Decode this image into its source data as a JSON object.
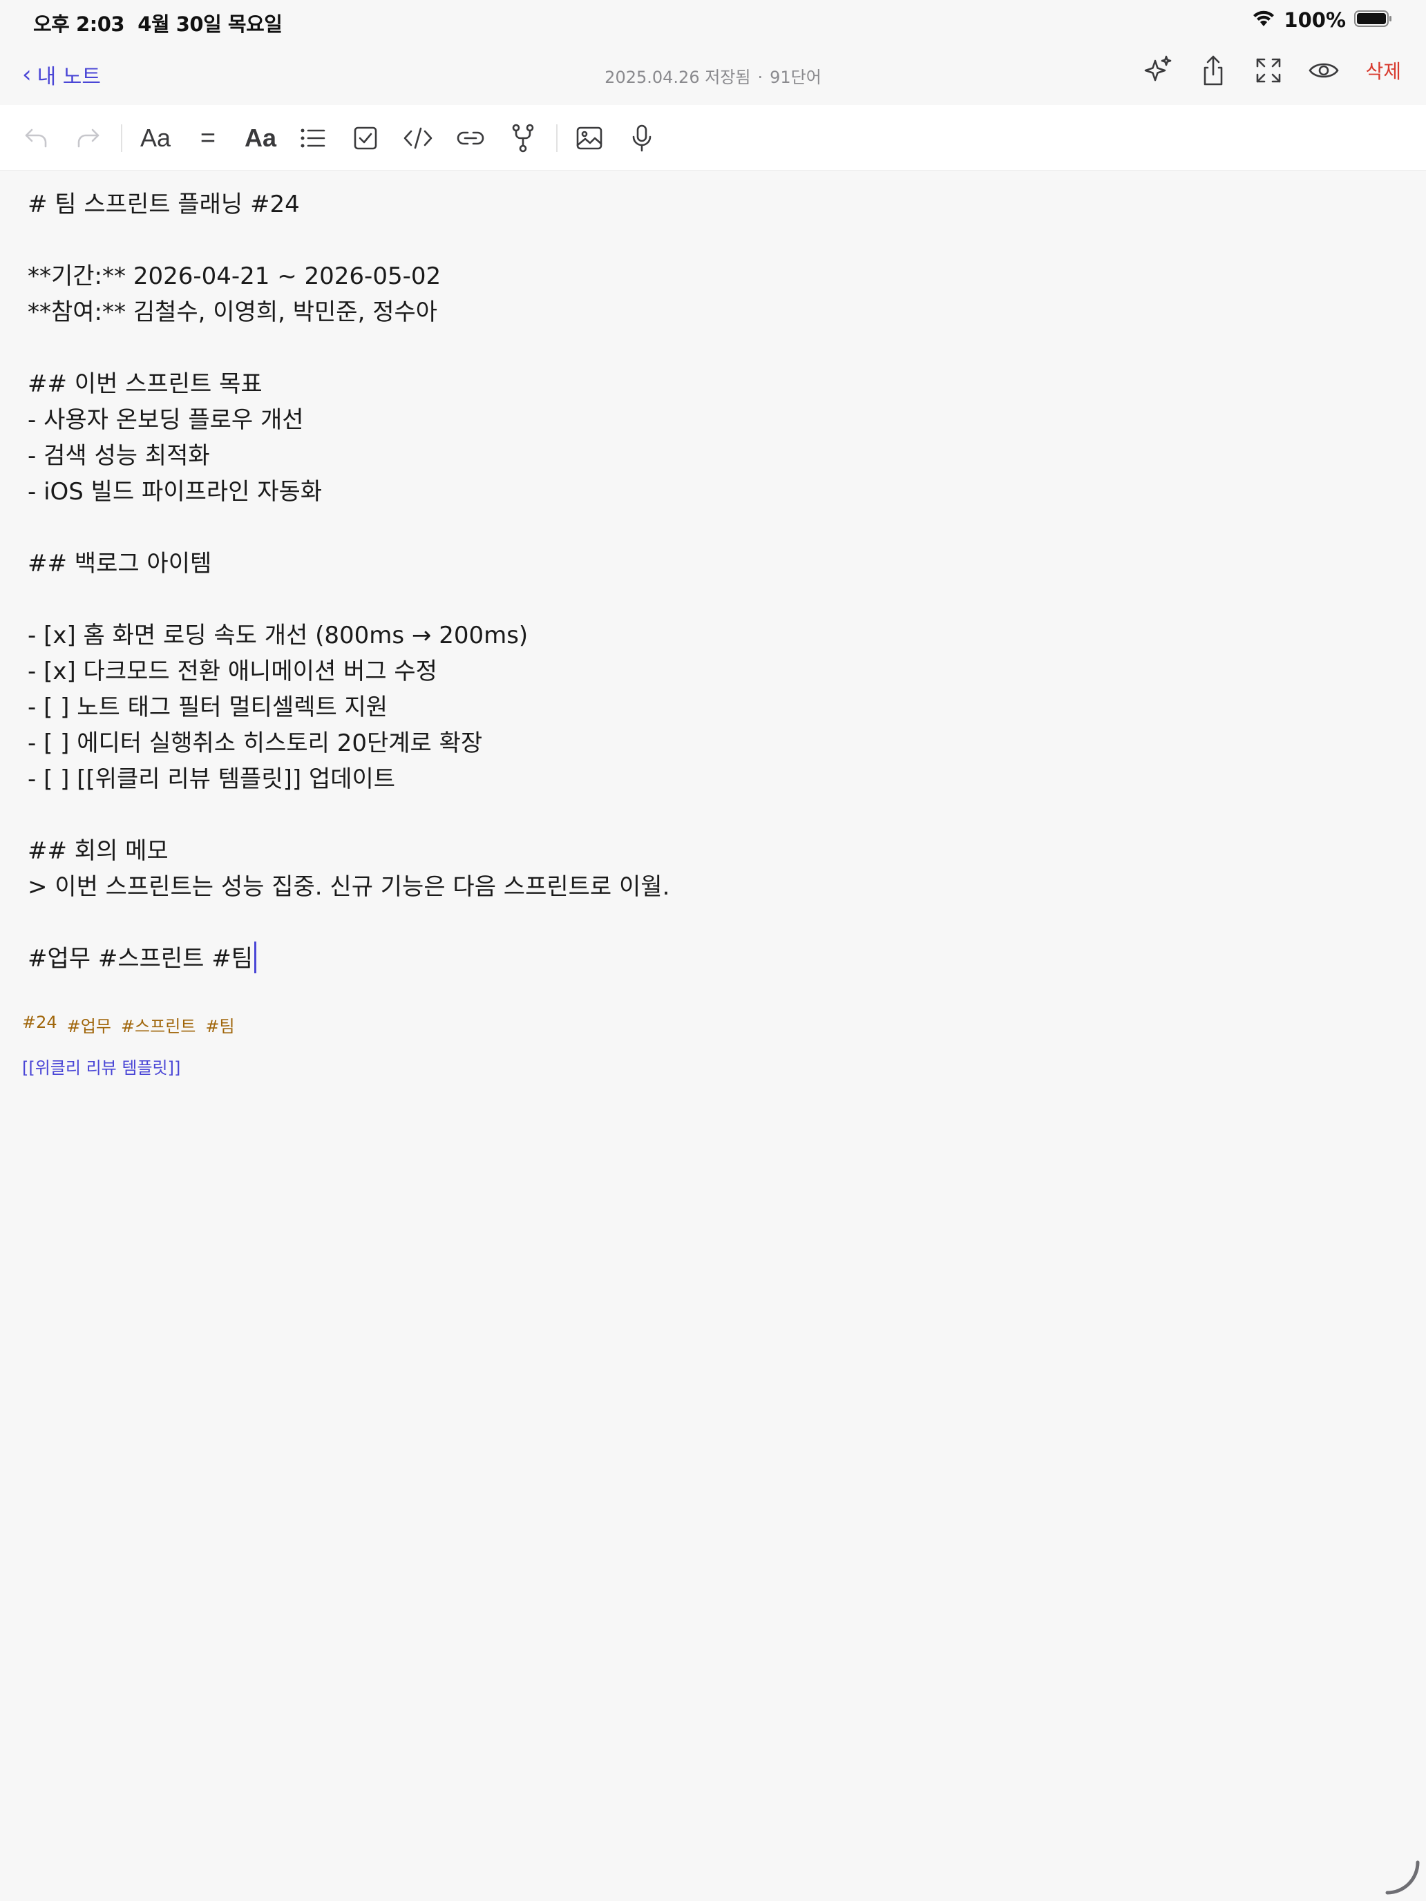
{
  "status_bar": {
    "time": "오후 2:03",
    "date": "4월 30일 목요일",
    "battery": "100%"
  },
  "nav": {
    "back_label": "내 노트",
    "saved_text": "2025.04.26 저장됨",
    "separator": "·",
    "word_count": "91단어",
    "delete_label": "삭제"
  },
  "toolbar": {
    "text_style_label": "Aa",
    "heading_label": "Aa",
    "divider_label": "="
  },
  "editor": {
    "lines": [
      "# 팀 스프린트 플래닝 #24",
      "",
      "**기간:** 2026-04-21 ~ 2026-05-02",
      "**참여:** 김철수, 이영희, 박민준, 정수아",
      "",
      "## 이번 스프린트 목표",
      "- 사용자 온보딩 플로우 개선",
      "- 검색 성능 최적화",
      "- iOS 빌드 파이프라인 자동화",
      "",
      "## 백로그 아이템",
      "",
      "- [x] 홈 화면 로딩 속도 개선 (800ms → 200ms)",
      "- [x] 다크모드 전환 애니메이션 버그 수정",
      "- [ ] 노트 태그 필터 멀티셀렉트 지원",
      "- [ ] 에디터 실행취소 히스토리 20단계로 확장",
      "- [ ] [[위클리 리뷰 템플릿]] 업데이트",
      "",
      "## 회의 메모",
      "> 이번 스프린트는 성능 집중. 신규 기능은 다음 스프린트로 이월.",
      "",
      "#업무 #스프린트 #팀"
    ]
  },
  "tags": [
    "#24",
    "#업무",
    "#스프린트",
    "#팀"
  ],
  "wikilink": "[[위클리 리뷰 템플릿]]",
  "colors": {
    "accent": "#4a46d6",
    "delete": "#d83a2e",
    "tag": "#a0660b",
    "background": "#f7f7f7"
  }
}
